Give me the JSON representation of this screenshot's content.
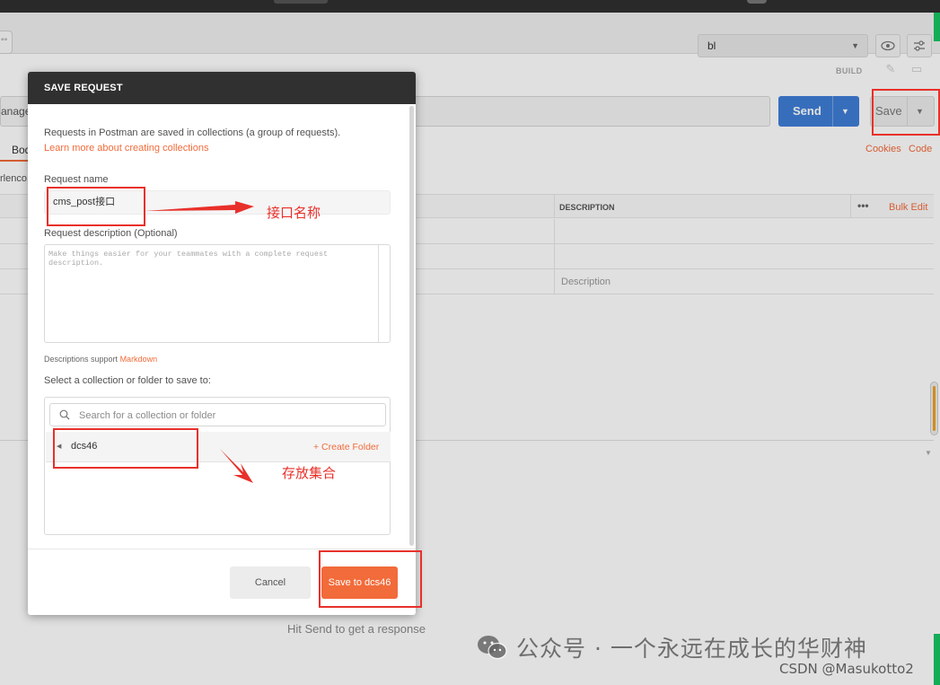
{
  "app": {
    "env_value": "bl",
    "build_label": "BUILD",
    "tab_stub": "°°",
    "url_fragment": "anage",
    "send_label": "Send",
    "save_label": "Save",
    "body_tab": "Bod",
    "encoding_fragment": "rlenco",
    "cookies_link": "Cookies",
    "code_link": "Code",
    "col_description": "DESCRIPTION",
    "more_dots": "•••",
    "bulk_edit": "Bulk Edit",
    "description_placeholder": "Description",
    "hit_send": "Hit Send to get a response"
  },
  "modal": {
    "title": "SAVE REQUEST",
    "intro": "Requests in Postman are saved in collections (a group of requests).",
    "learn_more": "Learn more about creating collections",
    "name_label": "Request name",
    "name_value": "cms_post接口",
    "desc_label": "Request description (Optional)",
    "desc_placeholder": "Make things easier for your teammates with a complete request description.",
    "markdown_prefix": "Descriptions support",
    "markdown_link": "Markdown",
    "select_label": "Select a collection or folder to save to:",
    "search_placeholder": "Search for a collection or folder",
    "collection_name": "dcs46",
    "create_folder": "+ Create Folder",
    "cancel": "Cancel",
    "save_to": "Save to dcs46"
  },
  "annotations": {
    "name_note": "接口名称",
    "collection_note": "存放集合",
    "color": "#e8302a"
  },
  "watermark": {
    "text": "公众号 · 一个永远在成长的华财神",
    "csdn": "CSDN @Masukotto2"
  },
  "colors": {
    "accent": "#f26b3a",
    "send_blue": "#3f7ed6",
    "header_dark": "#303030",
    "status_green": "#19c463"
  }
}
